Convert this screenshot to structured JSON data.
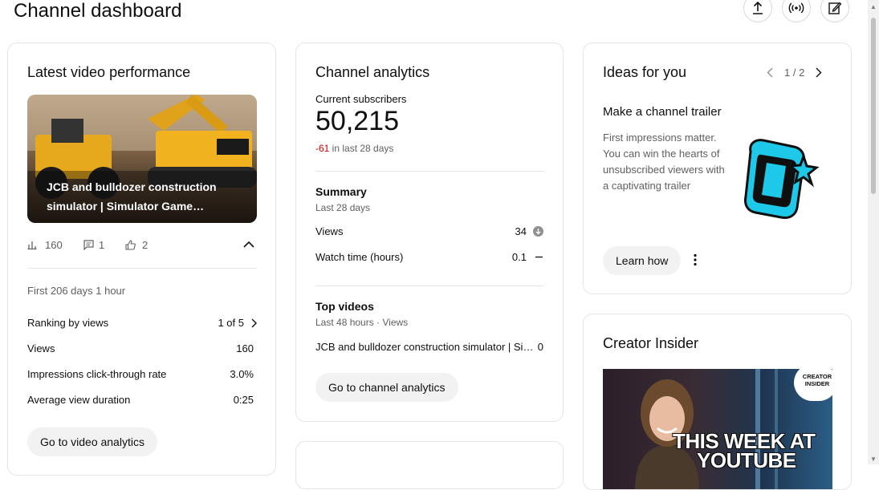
{
  "header": {
    "title": "Channel dashboard"
  },
  "top_actions": [
    {
      "icon": "upload-icon"
    },
    {
      "icon": "live-icon"
    },
    {
      "icon": "edit-icon"
    }
  ],
  "latest_video": {
    "card_title": "Latest video performance",
    "thumbnail_title": "JCB and bulldozer construction simulator | Simulator Game…",
    "stats": {
      "views": "160",
      "comments": "1",
      "likes": "2"
    },
    "period": "First 206 days 1 hour",
    "metrics": [
      {
        "label": "Ranking by views",
        "value": "1 of 5"
      },
      {
        "label": "Views",
        "value": "160"
      },
      {
        "label": "Impressions click-through rate",
        "value": "3.0%"
      },
      {
        "label": "Average view duration",
        "value": "0:25"
      }
    ],
    "button": "Go to video analytics"
  },
  "analytics": {
    "card_title": "Channel analytics",
    "subs_label": "Current subscribers",
    "subs_value": "50,215",
    "subs_change": "-61",
    "subs_change_suffix": " in last 28 days",
    "summary_title": "Summary",
    "summary_period": "Last 28 days",
    "summary_rows": [
      {
        "label": "Views",
        "value": "34"
      },
      {
        "label": "Watch time (hours)",
        "value": "0.1"
      }
    ],
    "top_title": "Top videos",
    "top_period": "Last 48 hours · Views",
    "top_video": {
      "title": "JCB and bulldozer construction simulator | Si…",
      "views": "0"
    },
    "button": "Go to channel analytics"
  },
  "ideas": {
    "card_title": "Ideas for you",
    "pager": "1 / 2",
    "heading": "Make a channel trailer",
    "body": "First impressions matter. You can win the hearts of unsubscribed viewers with a captivating trailer",
    "button": "Learn how"
  },
  "creator": {
    "card_title": "Creator Insider",
    "badge_line1": "CREATOR",
    "badge_line2": "INSIDER",
    "overlay_line1": "THIS WEEK AT",
    "overlay_line2": "YOUTUBE"
  },
  "colors": {
    "negative": "#cc0000",
    "accent_cyan": "#1ec8e8"
  }
}
